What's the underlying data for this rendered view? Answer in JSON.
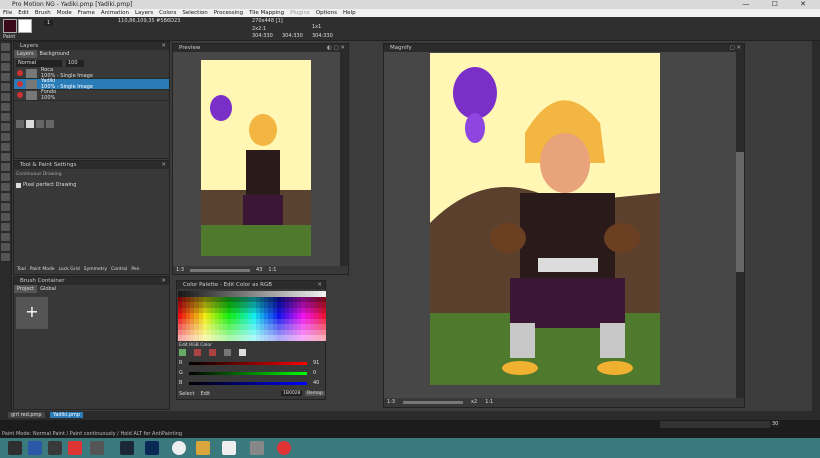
{
  "window": {
    "title": "Pro Motion NG - Yadiki.pmp [Yadiki.pmp]",
    "controls": "— ☐ ✕"
  },
  "menu": [
    "File",
    "Edit",
    "Brush",
    "Mode",
    "Frame",
    "Animation",
    "Layers",
    "Colors",
    "Selection",
    "Processing",
    "Tile Mapping",
    "Plugins",
    "Options",
    "Help"
  ],
  "toolbar": {
    "coords": "110,86,109,35 #5B6D23",
    "size1": "270x448 [1]",
    "size2": "2x2:1",
    "pos1": "304:330",
    "pos2": "304:330",
    "pos3": "304:330",
    "label_paint": "Paint",
    "brush_size": "1",
    "extra": "1x1",
    "fg_color": "#3a0a1a"
  },
  "layers": {
    "title": "Layers",
    "tabs": [
      "Layers",
      "Background"
    ],
    "blend": "Normal",
    "opacity": "100",
    "rows": [
      {
        "name": "Roca",
        "info": "100% - Single Image"
      },
      {
        "name": "Yadiki",
        "info": "100% - Single Image"
      },
      {
        "name": "Fondo",
        "info": "100%"
      }
    ]
  },
  "tool_settings": {
    "title": "Tool & Paint Settings",
    "subtitle": "Continuous Drawing",
    "option": "Pixel perfect Drawing",
    "tabs": [
      "Tool",
      "Paint Mode",
      "Lock Grid",
      "Symmetry",
      "Control",
      "Pen"
    ]
  },
  "brush": {
    "title": "Brush Container",
    "tabs": [
      "Project",
      "Global"
    ],
    "add": "+"
  },
  "preview": {
    "title": "Preview",
    "zoom": "1:3",
    "frame": "43",
    "ratio": "1:1"
  },
  "palette": {
    "title": "Color Palette - Edit Color as RGB",
    "section": "Edit RGB Color",
    "rgb": [
      {
        "ch": "R",
        "val": "91"
      },
      {
        "ch": "G",
        "val": "0"
      },
      {
        "ch": "B",
        "val": "40"
      }
    ],
    "hex": "1B0028",
    "buttons": [
      "Select",
      "Edit"
    ],
    "remap": "Remap"
  },
  "magnify": {
    "title": "Magnify",
    "zoom": "1:3",
    "mult": "x2",
    "ratio": "1:1"
  },
  "file_tabs": [
    "girl red.pmp",
    "Yadiki.pmp"
  ],
  "frame_num": "30",
  "status": "Paint Mode: Normal Paint / Paint continuously / Hold ALT for AntiPainting",
  "colors": {
    "accent": "#2a7cb8",
    "taskbar": "#3a7a7e",
    "sky": "#fff7b3"
  }
}
